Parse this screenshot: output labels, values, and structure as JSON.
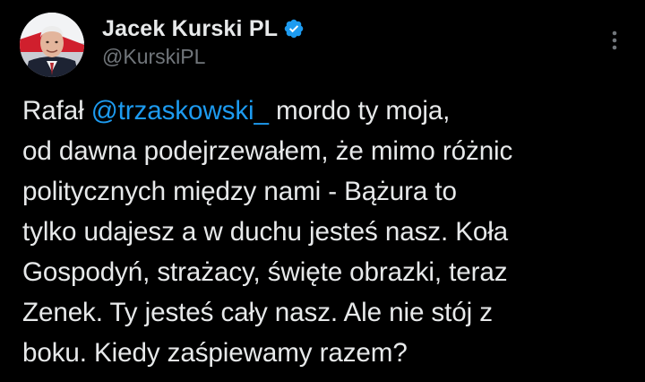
{
  "author": {
    "display_name": "Jacek Kurski PL",
    "handle": "@KurskiPL",
    "verified": true
  },
  "icons": {
    "verified": "verified-badge-icon",
    "more": "more-vertical-icon"
  },
  "tweet": {
    "text_before": "Rafał ",
    "mention": "@trzaskowski_",
    "text_after": " mordo ty moja,\nod dawna podejrzewałem, że mimo różnic\npolitycznych między nami - Bążura to\ntylko udajesz a w duchu jesteś nasz. Koła\nGospodyń, strażacy, święte obrazki, teraz\nZenek. Ty jesteś cały nasz. Ale nie stój z\nboku. Kiedy zaśpiewamy razem?"
  },
  "colors": {
    "background": "#000000",
    "text": "#e7e9ea",
    "secondary_text": "#71767b",
    "link": "#1d9bf0",
    "verified": "#1d9bf0"
  }
}
